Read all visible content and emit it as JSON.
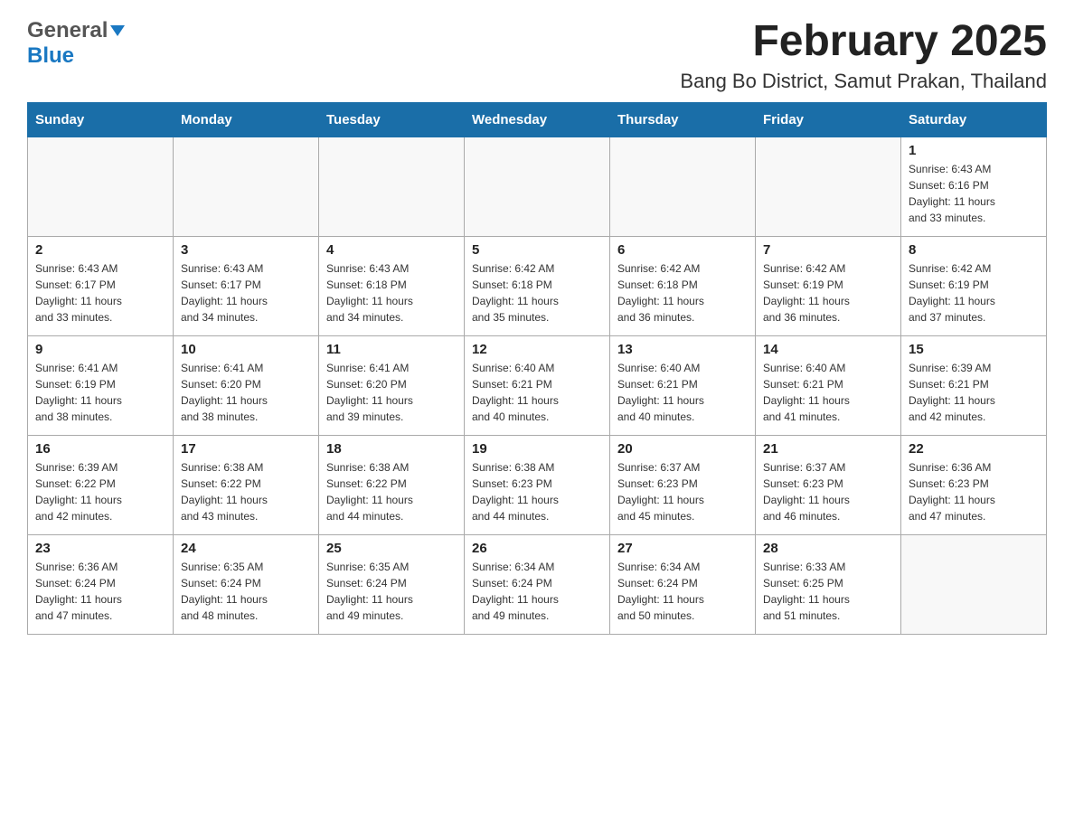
{
  "header": {
    "logo_general": "General",
    "logo_blue": "Blue",
    "title": "February 2025",
    "subtitle": "Bang Bo District, Samut Prakan, Thailand"
  },
  "weekdays": [
    "Sunday",
    "Monday",
    "Tuesday",
    "Wednesday",
    "Thursday",
    "Friday",
    "Saturday"
  ],
  "weeks": [
    [
      {
        "day": "",
        "info": ""
      },
      {
        "day": "",
        "info": ""
      },
      {
        "day": "",
        "info": ""
      },
      {
        "day": "",
        "info": ""
      },
      {
        "day": "",
        "info": ""
      },
      {
        "day": "",
        "info": ""
      },
      {
        "day": "1",
        "info": "Sunrise: 6:43 AM\nSunset: 6:16 PM\nDaylight: 11 hours\nand 33 minutes."
      }
    ],
    [
      {
        "day": "2",
        "info": "Sunrise: 6:43 AM\nSunset: 6:17 PM\nDaylight: 11 hours\nand 33 minutes."
      },
      {
        "day": "3",
        "info": "Sunrise: 6:43 AM\nSunset: 6:17 PM\nDaylight: 11 hours\nand 34 minutes."
      },
      {
        "day": "4",
        "info": "Sunrise: 6:43 AM\nSunset: 6:18 PM\nDaylight: 11 hours\nand 34 minutes."
      },
      {
        "day": "5",
        "info": "Sunrise: 6:42 AM\nSunset: 6:18 PM\nDaylight: 11 hours\nand 35 minutes."
      },
      {
        "day": "6",
        "info": "Sunrise: 6:42 AM\nSunset: 6:18 PM\nDaylight: 11 hours\nand 36 minutes."
      },
      {
        "day": "7",
        "info": "Sunrise: 6:42 AM\nSunset: 6:19 PM\nDaylight: 11 hours\nand 36 minutes."
      },
      {
        "day": "8",
        "info": "Sunrise: 6:42 AM\nSunset: 6:19 PM\nDaylight: 11 hours\nand 37 minutes."
      }
    ],
    [
      {
        "day": "9",
        "info": "Sunrise: 6:41 AM\nSunset: 6:19 PM\nDaylight: 11 hours\nand 38 minutes."
      },
      {
        "day": "10",
        "info": "Sunrise: 6:41 AM\nSunset: 6:20 PM\nDaylight: 11 hours\nand 38 minutes."
      },
      {
        "day": "11",
        "info": "Sunrise: 6:41 AM\nSunset: 6:20 PM\nDaylight: 11 hours\nand 39 minutes."
      },
      {
        "day": "12",
        "info": "Sunrise: 6:40 AM\nSunset: 6:21 PM\nDaylight: 11 hours\nand 40 minutes."
      },
      {
        "day": "13",
        "info": "Sunrise: 6:40 AM\nSunset: 6:21 PM\nDaylight: 11 hours\nand 40 minutes."
      },
      {
        "day": "14",
        "info": "Sunrise: 6:40 AM\nSunset: 6:21 PM\nDaylight: 11 hours\nand 41 minutes."
      },
      {
        "day": "15",
        "info": "Sunrise: 6:39 AM\nSunset: 6:21 PM\nDaylight: 11 hours\nand 42 minutes."
      }
    ],
    [
      {
        "day": "16",
        "info": "Sunrise: 6:39 AM\nSunset: 6:22 PM\nDaylight: 11 hours\nand 42 minutes."
      },
      {
        "day": "17",
        "info": "Sunrise: 6:38 AM\nSunset: 6:22 PM\nDaylight: 11 hours\nand 43 minutes."
      },
      {
        "day": "18",
        "info": "Sunrise: 6:38 AM\nSunset: 6:22 PM\nDaylight: 11 hours\nand 44 minutes."
      },
      {
        "day": "19",
        "info": "Sunrise: 6:38 AM\nSunset: 6:23 PM\nDaylight: 11 hours\nand 44 minutes."
      },
      {
        "day": "20",
        "info": "Sunrise: 6:37 AM\nSunset: 6:23 PM\nDaylight: 11 hours\nand 45 minutes."
      },
      {
        "day": "21",
        "info": "Sunrise: 6:37 AM\nSunset: 6:23 PM\nDaylight: 11 hours\nand 46 minutes."
      },
      {
        "day": "22",
        "info": "Sunrise: 6:36 AM\nSunset: 6:23 PM\nDaylight: 11 hours\nand 47 minutes."
      }
    ],
    [
      {
        "day": "23",
        "info": "Sunrise: 6:36 AM\nSunset: 6:24 PM\nDaylight: 11 hours\nand 47 minutes."
      },
      {
        "day": "24",
        "info": "Sunrise: 6:35 AM\nSunset: 6:24 PM\nDaylight: 11 hours\nand 48 minutes."
      },
      {
        "day": "25",
        "info": "Sunrise: 6:35 AM\nSunset: 6:24 PM\nDaylight: 11 hours\nand 49 minutes."
      },
      {
        "day": "26",
        "info": "Sunrise: 6:34 AM\nSunset: 6:24 PM\nDaylight: 11 hours\nand 49 minutes."
      },
      {
        "day": "27",
        "info": "Sunrise: 6:34 AM\nSunset: 6:24 PM\nDaylight: 11 hours\nand 50 minutes."
      },
      {
        "day": "28",
        "info": "Sunrise: 6:33 AM\nSunset: 6:25 PM\nDaylight: 11 hours\nand 51 minutes."
      },
      {
        "day": "",
        "info": ""
      }
    ]
  ]
}
